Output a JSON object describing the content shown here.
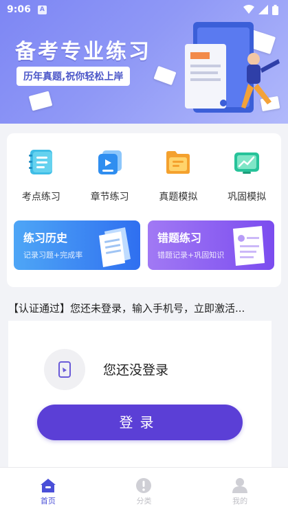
{
  "status_bar": {
    "time": "9:06",
    "notification_glyph": "A"
  },
  "banner": {
    "title": "备考专业练习",
    "subtitle": "历年真题,祝你轻松上岸"
  },
  "grid": {
    "items": [
      {
        "label": "考点练习",
        "icon": "notebook-icon",
        "color": "#3fbde6"
      },
      {
        "label": "章节练习",
        "icon": "video-card-icon",
        "color": "#2f8ef0"
      },
      {
        "label": "真题模拟",
        "icon": "folder-message-icon",
        "color": "#f4a12e"
      },
      {
        "label": "巩固模拟",
        "icon": "chart-board-icon",
        "color": "#27c39a"
      }
    ]
  },
  "features": [
    {
      "title": "练习历史",
      "subtitle": "记录习题+完成率",
      "color_from": "#4ea6f6",
      "color_to": "#2f6ff0"
    },
    {
      "title": "错题练习",
      "subtitle": "错题记录+巩固知识",
      "color_from": "#a179f4",
      "color_to": "#7b4cef"
    }
  ],
  "notice": "【认证通过】您还未登录，输入手机号，立即激活...",
  "login": {
    "message": "您还没登录",
    "button_label": "登录"
  },
  "tabbar": {
    "tabs": [
      {
        "label": "首页",
        "icon": "home-icon",
        "active": true
      },
      {
        "label": "分类",
        "icon": "category-icon",
        "active": false
      },
      {
        "label": "我的",
        "icon": "profile-icon",
        "active": false
      }
    ]
  },
  "colors": {
    "accent": "#5b3fd6",
    "tab_active": "#4a4fd8",
    "banner": "#7d86f4"
  }
}
